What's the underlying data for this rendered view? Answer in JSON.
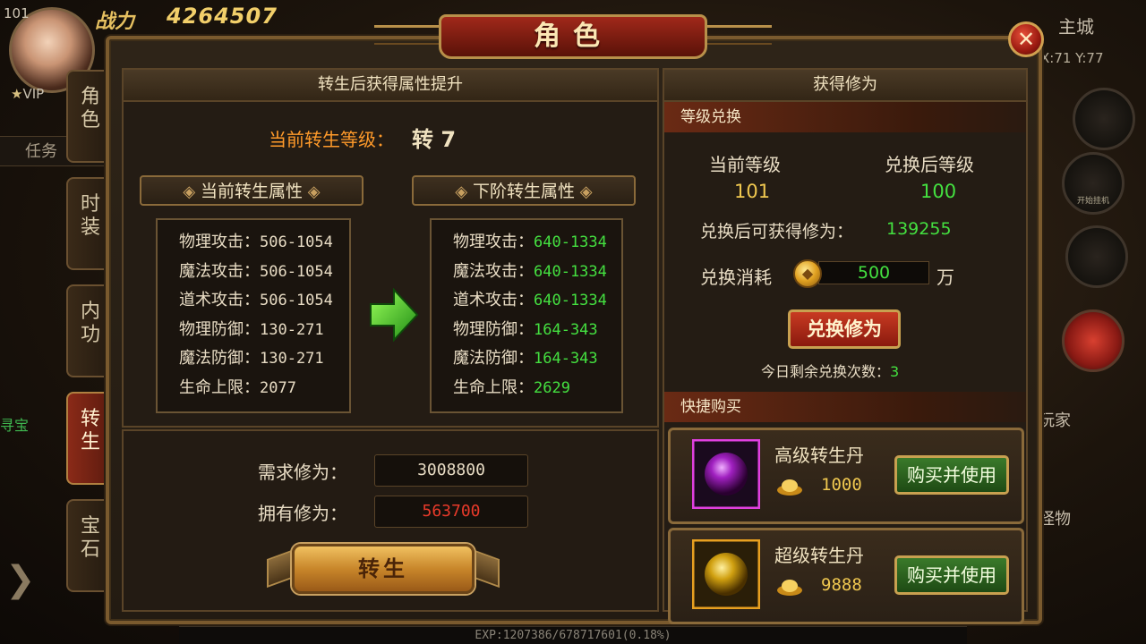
{
  "hud": {
    "level": "101",
    "power_label": "战力",
    "power_value": "4264507",
    "vip": "VIP",
    "task_tab": "任务",
    "treasure_fragment": "寻宝",
    "city": "主城",
    "coord": "X:71 Y:77",
    "auto_battle": "开始挂机",
    "player": "玩家",
    "monster": "怪物",
    "exp": "EXP:1207386/678717601(0.18%)"
  },
  "window": {
    "title": "角色",
    "close": "✕"
  },
  "tabs": [
    {
      "label": "角色",
      "active": false
    },
    {
      "label": "时装",
      "active": false
    },
    {
      "label": "内功",
      "active": false
    },
    {
      "label": "转生",
      "active": true
    },
    {
      "label": "宝石",
      "active": false
    }
  ],
  "rebirth": {
    "header": "转生后获得属性提升",
    "current_level_label": "当前转生等级：",
    "current_level_value": "转 7",
    "current_attrs_title": "当前转生属性",
    "next_attrs_title": "下阶转生属性",
    "current_attrs": [
      {
        "label": "物理攻击：",
        "value": "506-1054"
      },
      {
        "label": "魔法攻击：",
        "value": "506-1054"
      },
      {
        "label": "道术攻击：",
        "value": "506-1054"
      },
      {
        "label": "物理防御：",
        "value": "130-271"
      },
      {
        "label": "魔法防御：",
        "value": "130-271"
      },
      {
        "label": "生命上限：",
        "value": "2077"
      }
    ],
    "next_attrs": [
      {
        "label": "物理攻击：",
        "value": "640-1334"
      },
      {
        "label": "魔法攻击：",
        "value": "640-1334"
      },
      {
        "label": "道术攻击：",
        "value": "640-1334"
      },
      {
        "label": "物理防御：",
        "value": "164-343"
      },
      {
        "label": "魔法防御：",
        "value": "164-343"
      },
      {
        "label": "生命上限：",
        "value": "2629"
      }
    ],
    "required_label": "需求修为：",
    "required_value": "3008800",
    "owned_label": "拥有修为：",
    "owned_value": "563700",
    "rebirth_button": "转生"
  },
  "cultivation": {
    "header": "获得修为",
    "exchange_section": "等级兑换",
    "current_level_label": "当前等级",
    "after_level_label": "兑换后等级",
    "current_level": "101",
    "after_level": "100",
    "gain_label": "兑换后可获得修为：",
    "gain_value": "139255",
    "cost_label": "兑换消耗",
    "cost_value": "500",
    "cost_unit": "万",
    "exchange_button": "兑换修为",
    "remaining_label": "今日剩余兑换次数：",
    "remaining_value": "3"
  },
  "quick_buy": {
    "section": "快捷购买",
    "items": [
      {
        "name": "高级转生丹",
        "price": "1000",
        "button": "购买并使用"
      },
      {
        "name": "超级转生丹",
        "price": "9888",
        "button": "购买并使用"
      }
    ]
  },
  "colors": {
    "accent_gold": "#f0c850",
    "value_green": "#44e040",
    "value_red": "#e83a2a",
    "label_orange": "#ff9a2a"
  }
}
